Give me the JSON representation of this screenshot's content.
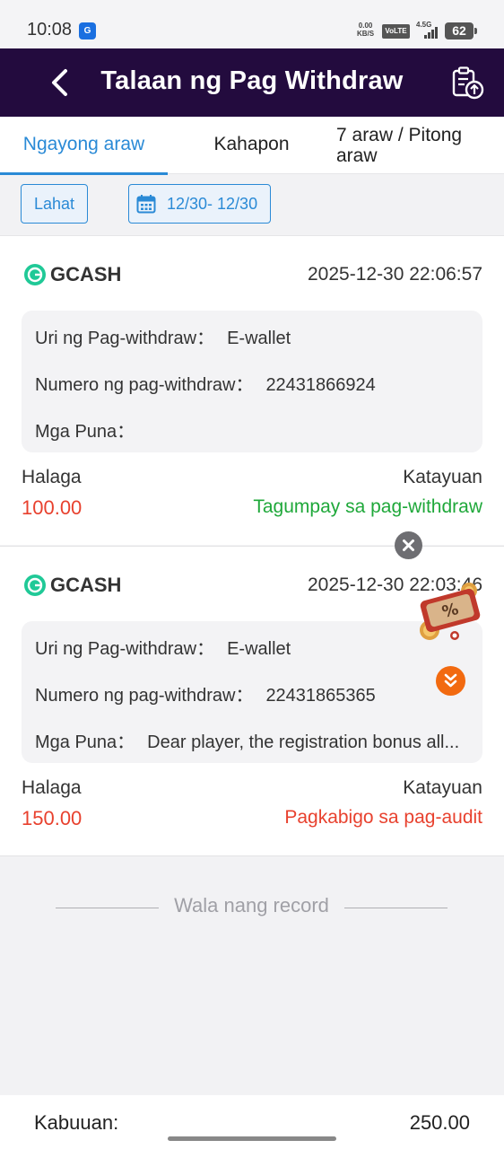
{
  "status_bar": {
    "time": "10:08",
    "app_icon_label": "G",
    "net_speed_value": "0.00",
    "net_speed_unit": "KB/S",
    "volte": "VoLTE",
    "network": "4.5G",
    "battery": "62"
  },
  "header": {
    "title": "Talaan ng Pag Withdraw"
  },
  "tabs": [
    {
      "label": "Ngayong araw",
      "active": true
    },
    {
      "label": "Kahapon",
      "active": false
    },
    {
      "label": "7 araw / Pitong araw",
      "active": false
    }
  ],
  "filters": {
    "all_label": "Lahat",
    "date_range": "12/30- 12/30"
  },
  "records": [
    {
      "method": "GCASH",
      "datetime": "2025-12-30 22:06:57",
      "type_label": "Uri ng Pag-withdraw：",
      "type_value": "E-wallet",
      "number_label": "Numero ng pag-withdraw：",
      "number_value": "22431866924",
      "remarks_label": "Mga Puna：",
      "remarks_value": "",
      "amount_label": "Halaga",
      "amount_value": "100.00",
      "status_label": "Katayuan",
      "status_value": "Tagumpay sa pag-withdraw",
      "status_color": "#1fa83a"
    },
    {
      "method": "GCASH",
      "datetime": "2025-12-30 22:03:46",
      "type_label": "Uri ng Pag-withdraw：",
      "type_value": "E-wallet",
      "number_label": "Numero ng pag-withdraw：",
      "number_value": "22431865365",
      "remarks_label": "Mga Puna：",
      "remarks_value": "Dear player, the registration bonus all...",
      "amount_label": "Halaga",
      "amount_value": "150.00",
      "status_label": "Katayuan",
      "status_value": "Pagkabigo sa pag-audit",
      "status_color": "#e8412e"
    }
  ],
  "end_of_list": "Wala nang record",
  "footer": {
    "total_label": "Kabuuan:",
    "total_value": "250.00"
  },
  "colors": {
    "header_bg": "#230b3e",
    "accent": "#2a8ad6",
    "amount": "#e8412e",
    "success": "#1fa83a",
    "failure": "#e8412e",
    "gcash": "#20c997"
  }
}
